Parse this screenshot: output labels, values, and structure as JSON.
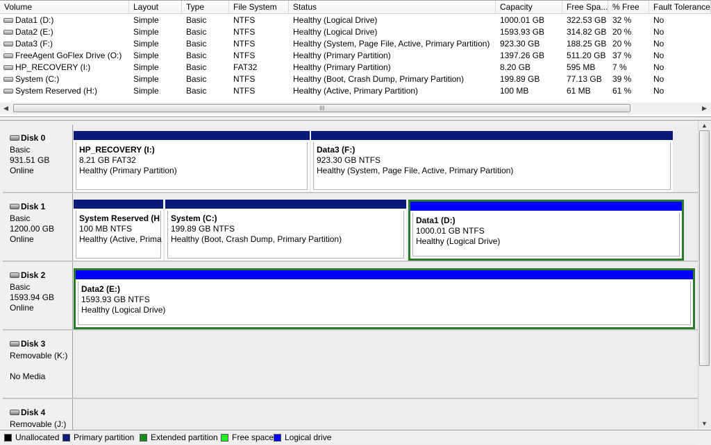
{
  "columns": [
    "Volume",
    "Layout",
    "Type",
    "File System",
    "Status",
    "Capacity",
    "Free Spa...",
    "% Free",
    "Fault Tolerance"
  ],
  "volumes": [
    {
      "volume": "Data1 (D:)",
      "layout": "Simple",
      "type": "Basic",
      "fs": "NTFS",
      "status": "Healthy (Logical Drive)",
      "capacity": "1000.01 GB",
      "free": "322.53 GB",
      "pct": "32 %",
      "fault": "No"
    },
    {
      "volume": "Data2 (E:)",
      "layout": "Simple",
      "type": "Basic",
      "fs": "NTFS",
      "status": "Healthy (Logical Drive)",
      "capacity": "1593.93 GB",
      "free": "314.82 GB",
      "pct": "20 %",
      "fault": "No"
    },
    {
      "volume": "Data3 (F:)",
      "layout": "Simple",
      "type": "Basic",
      "fs": "NTFS",
      "status": "Healthy (System, Page File, Active, Primary Partition)",
      "capacity": "923.30 GB",
      "free": "188.25 GB",
      "pct": "20 %",
      "fault": "No"
    },
    {
      "volume": "FreeAgent GoFlex Drive (O:)",
      "layout": "Simple",
      "type": "Basic",
      "fs": "NTFS",
      "status": "Healthy (Primary Partition)",
      "capacity": "1397.26 GB",
      "free": "511.20 GB",
      "pct": "37 %",
      "fault": "No"
    },
    {
      "volume": "HP_RECOVERY (I:)",
      "layout": "Simple",
      "type": "Basic",
      "fs": "FAT32",
      "status": "Healthy (Primary Partition)",
      "capacity": "8.20 GB",
      "free": "595 MB",
      "pct": "7 %",
      "fault": "No"
    },
    {
      "volume": "System (C:)",
      "layout": "Simple",
      "type": "Basic",
      "fs": "NTFS",
      "status": "Healthy (Boot, Crash Dump, Primary Partition)",
      "capacity": "199.89 GB",
      "free": "77.13 GB",
      "pct": "39 %",
      "fault": "No"
    },
    {
      "volume": "System Reserved (H:)",
      "layout": "Simple",
      "type": "Basic",
      "fs": "NTFS",
      "status": "Healthy (Active, Primary Partition)",
      "capacity": "100 MB",
      "free": "61 MB",
      "pct": "61 %",
      "fault": "No"
    }
  ],
  "scroll_grip": "III",
  "disks": [
    {
      "name": "Disk 0",
      "line1": "Basic",
      "line2": "931.51 GB",
      "line3": "Online",
      "partitions": [
        {
          "title": "HP_RECOVERY  (I:)",
          "size": "8.21 GB FAT32",
          "status": "Healthy (Primary Partition)",
          "kind": "primary"
        },
        {
          "title": "Data3  (F:)",
          "size": "923.30 GB NTFS",
          "status": "Healthy (System, Page File, Active, Primary Partition)",
          "kind": "primary"
        }
      ]
    },
    {
      "name": "Disk 1",
      "line1": "Basic",
      "line2": "1200.00 GB",
      "line3": "Online",
      "partitions": [
        {
          "title": "System Reserved  (H",
          "size": "100 MB NTFS",
          "status": "Healthy (Active, Prima",
          "kind": "primary"
        },
        {
          "title": "System  (C:)",
          "size": "199.89 GB NTFS",
          "status": "Healthy (Boot, Crash Dump, Primary Partition)",
          "kind": "primary"
        },
        {
          "title": "Data1  (D:)",
          "size": "1000.01 GB NTFS",
          "status": "Healthy (Logical Drive)",
          "kind": "logical",
          "selected": true
        }
      ]
    },
    {
      "name": "Disk 2",
      "line1": "Basic",
      "line2": "1593.94 GB",
      "line3": "Online",
      "partitions": [
        {
          "title": "Data2  (E:)",
          "size": "1593.93 GB NTFS",
          "status": "Healthy (Logical Drive)",
          "kind": "logical",
          "selected": true
        }
      ]
    },
    {
      "name": "Disk 3",
      "line1": "Removable (K:)",
      "line2": "",
      "line3": "No Media",
      "partitions": []
    },
    {
      "name": "Disk 4",
      "line1": "Removable (J:)",
      "line2": "",
      "line3": "",
      "partitions": []
    }
  ],
  "legend": [
    {
      "label": "Unallocated",
      "color": "#000000"
    },
    {
      "label": "Primary partition",
      "color": "#0a1a7a"
    },
    {
      "label": "Extended partition",
      "color": "#1a8a1a"
    },
    {
      "label": "Free space",
      "color": "#22ee22"
    },
    {
      "label": "Logical drive",
      "color": "#0000ff"
    }
  ]
}
